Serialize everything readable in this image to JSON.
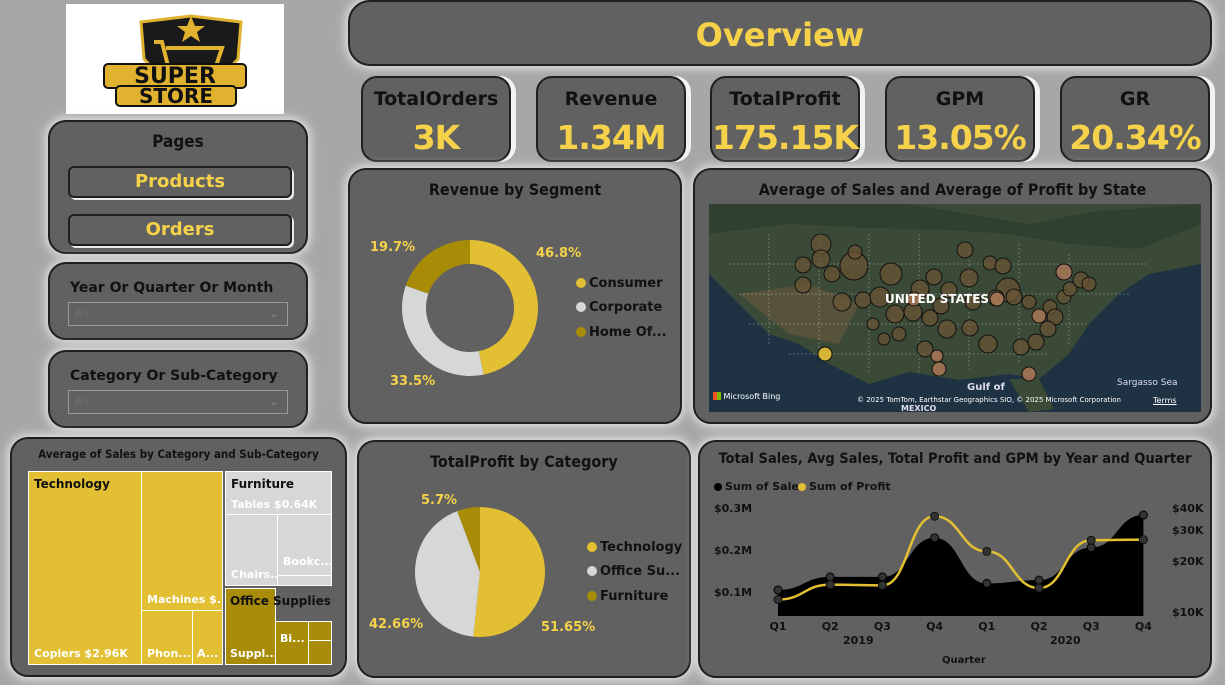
{
  "logo": {
    "line1": "SUPER",
    "line2": "STORE"
  },
  "header": {
    "title": "Overview"
  },
  "kpis": [
    {
      "label": "TotalOrders",
      "value": "3K"
    },
    {
      "label": "Revenue",
      "value": "1.34M"
    },
    {
      "label": "TotalProfit",
      "value": "175.15K"
    },
    {
      "label": "GPM",
      "value": "13.05%"
    },
    {
      "label": "GR",
      "value": "20.34%"
    }
  ],
  "pages": {
    "title": "Pages",
    "buttons": [
      "Products",
      "Orders"
    ]
  },
  "slicers": [
    {
      "label": "Year Or Quarter Or Month",
      "value": "All"
    },
    {
      "label": "Category Or Sub-Category",
      "value": "All"
    }
  ],
  "colors": {
    "gold": "#e2bf33",
    "light": "#d7d7d7",
    "dark_gold": "#a88c08",
    "black": "#000000",
    "value_yellow": "#f5d24a"
  },
  "segment": {
    "title": "Revenue by Segment",
    "legend": [
      "Consumer",
      "Corporate",
      "Home Of..."
    ],
    "labels": [
      "46.8%",
      "33.5%",
      "19.7%"
    ],
    "chart_data": {
      "type": "pie",
      "donut": true,
      "categories": [
        "Consumer",
        "Corporate",
        "Home Office"
      ],
      "values": [
        46.8,
        33.5,
        19.7
      ]
    }
  },
  "map": {
    "title": "Average of Sales and Average of Profit by State",
    "country_label": "UNITED STATES",
    "gulf_label": "Gulf of",
    "mexico_label": "MEXICO",
    "sea_label": "Sargasso Sea",
    "bing_label": "Microsoft Bing",
    "copyright": "© 2025 TomTom, Earthstar Geographics SIO, © 2025 Microsoft Corporation",
    "terms": "Terms"
  },
  "treemap": {
    "title": "Average of Sales by Category and Sub-Category",
    "tech": "Technology",
    "furn": "Furniture",
    "office": "Office Supplies",
    "copiers": "Copiers $2.96K",
    "machines": "Machines $...",
    "phones": "Phon...",
    "accessories": "A...",
    "tables": "Tables $0.64K",
    "chairs": "Chairs...",
    "bookcases": "Bookc...",
    "supplies": "Suppl...",
    "binders": "Bi..."
  },
  "category": {
    "title": "TotalProfit by Category",
    "legend": [
      "Technology",
      "Office Su...",
      "Furniture"
    ],
    "labels": [
      "51.65%",
      "42.66%",
      "5.7%"
    ],
    "chart_data": {
      "type": "pie",
      "categories": [
        "Technology",
        "Office Supplies",
        "Furniture"
      ],
      "values": [
        51.65,
        42.66,
        5.7
      ]
    }
  },
  "trend": {
    "title": "Total Sales, Avg Sales, Total Profit and GPM by Year and Quarter",
    "legend": [
      "Sum of Sales",
      "Sum of Profit"
    ],
    "y_left_ticks": [
      "$0.3M",
      "$0.2M",
      "$0.1M"
    ],
    "y_right_ticks": [
      "$40K",
      "$30K",
      "$20K",
      "$10K"
    ],
    "quarters": [
      "Q1",
      "Q2",
      "Q3",
      "Q4",
      "Q1",
      "Q2",
      "Q3",
      "Q4"
    ],
    "years": [
      "2019",
      "2020"
    ],
    "xlabel": "Quarter",
    "chart_data": {
      "type": "area",
      "categories": [
        "2019 Q1",
        "2019 Q2",
        "2019 Q3",
        "2019 Q4",
        "2020 Q1",
        "2020 Q2",
        "2020 Q3",
        "2020 Q4"
      ],
      "series": [
        {
          "name": "Sum of Sales",
          "axis": "left",
          "values": [
            0.08,
            0.12,
            0.12,
            0.24,
            0.1,
            0.11,
            0.21,
            0.31
          ]
        },
        {
          "name": "Sum of Profit",
          "axis": "right",
          "values": [
            6200,
            11800,
            11500,
            37500,
            24300,
            10500,
            28500,
            28700
          ]
        }
      ],
      "ylim_left": [
        0,
        0.35
      ],
      "ylim_right": [
        0,
        45000
      ]
    }
  }
}
